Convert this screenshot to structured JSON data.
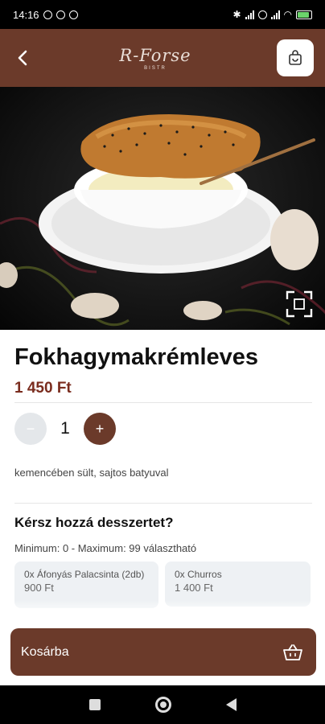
{
  "status": {
    "time": "14:16",
    "battery": "88"
  },
  "header": {
    "logo_main": "R-Forse",
    "logo_sub": "BISTR"
  },
  "product": {
    "name": "Fokhagymakrémleves",
    "price": "1 450 Ft",
    "quantity": "1",
    "description": "kemencében sült, sajtos batyuval"
  },
  "stepper": {
    "minus": "−",
    "plus": "+"
  },
  "addon": {
    "title": "Kérsz hozzá desszertet?",
    "limits": "Minimum: 0 - Maximum: 99 választható",
    "options": [
      {
        "name": "0x Áfonyás Palacsinta (2db)",
        "price": "900 Ft"
      },
      {
        "name": "0x Churros",
        "price": "1 400 Ft"
      }
    ]
  },
  "cta": {
    "label": "Kosárba"
  },
  "colors": {
    "brand": "#6b3a2a",
    "price": "#7a2c1e"
  }
}
